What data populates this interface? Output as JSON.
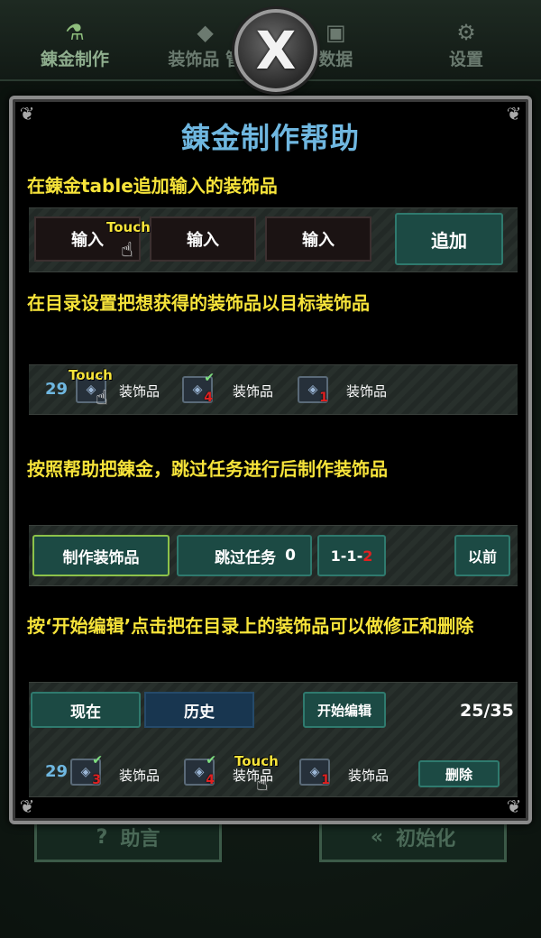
{
  "nav": {
    "items": [
      {
        "label": "錬金制作",
        "icon": "flask-icon"
      },
      {
        "label": "装饰品 管",
        "icon": "gem-icon"
      },
      {
        "label": "数据",
        "icon": "book-icon"
      },
      {
        "label": "设置",
        "icon": "gear-icon"
      }
    ]
  },
  "close_label": "X",
  "background_buttons": {
    "advice": "助言",
    "reset": "初始化"
  },
  "modal": {
    "title": "錬金制作帮助",
    "step1": {
      "text": "在錬金table追加输入的装饰品",
      "inputs": [
        "输入",
        "输入",
        "输入"
      ],
      "add": "追加",
      "touch": "Touch"
    },
    "step2": {
      "text": "在目录设置把想获得的装饰品以目标装饰品",
      "touch": "Touch",
      "qty": "29",
      "items": [
        {
          "label": "装饰品",
          "count": ""
        },
        {
          "label": "装饰品",
          "count": "4"
        },
        {
          "label": "装饰品",
          "count": "1"
        }
      ]
    },
    "step3": {
      "text": "按照帮助把錬金，跳过任务进行后制作装饰品",
      "make": "制作装饰品",
      "skip": "跳过任务",
      "skip_count": "0",
      "stage_prefix": "1-1-",
      "stage_last": "2",
      "prev": "以前"
    },
    "step4": {
      "text": "按‘开始编辑’点击把在目录上的装饰品可以做修正和删除",
      "tab_now": "现在",
      "tab_history": "历史",
      "edit": "开始编辑",
      "page_count": "25/35",
      "qty": "29",
      "touch": "Touch",
      "items": [
        {
          "label": "装饰品",
          "count": "3"
        },
        {
          "label": "装饰品",
          "count": "4"
        },
        {
          "label": "装饰品",
          "count": "1"
        }
      ],
      "delete": "删除"
    }
  },
  "colors": {
    "title": "#6fb7e0",
    "instruction": "#f6e33a",
    "button_teal": "#1c4a44",
    "button_navy": "#183650",
    "count_red": "#e02020"
  }
}
